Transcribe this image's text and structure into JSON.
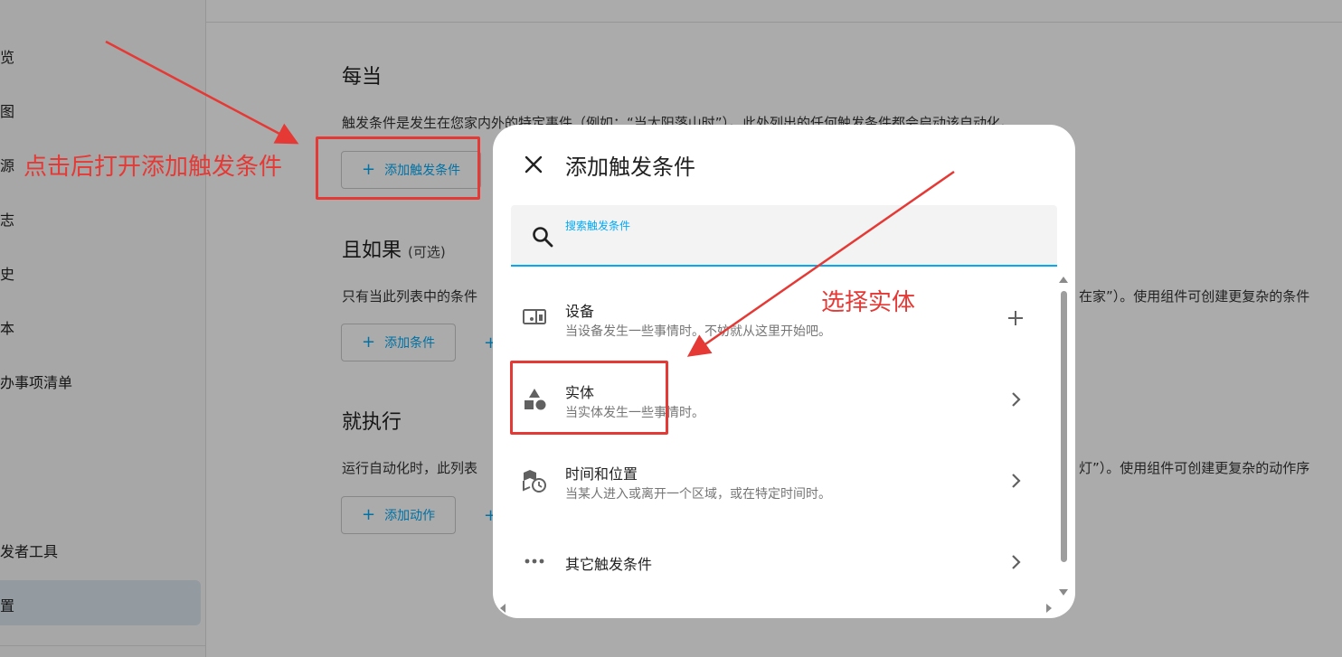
{
  "sidebar": {
    "items": [
      {
        "label": "览"
      },
      {
        "label": "图"
      },
      {
        "label": "源"
      },
      {
        "label": "志"
      },
      {
        "label": "史"
      },
      {
        "label": "本"
      },
      {
        "label": "办事项清单"
      },
      {
        "label": "发者工具"
      },
      {
        "label": "置"
      }
    ]
  },
  "main": {
    "trigger_section": {
      "title": "每当",
      "description": "触发条件是发生在您家内外的特定事件（例如：“当太阳落山时”）。此处列出的任何触发条件都会启动该自动化。",
      "add_button_label": "添加触发条件"
    },
    "condition_section": {
      "title": "且如果",
      "optional": "(可选)",
      "description_left": "只有当此列表中的条件",
      "description_right": "在家”）。使用组件可创建更复杂的条件",
      "add_button_label": "添加条件"
    },
    "action_section": {
      "title": "就执行",
      "description_left": "运行自动化时，此列表",
      "description_right": "灯”）。使用组件可创建更复杂的动作序",
      "add_button_label": "添加动作"
    }
  },
  "dialog": {
    "title": "添加触发条件",
    "search": {
      "label": "搜索触发条件",
      "value": ""
    },
    "items": [
      {
        "title": "设备",
        "subtitle": "当设备发生一些事情时。不妨就从这里开始吧。",
        "icon": "device-icon",
        "action": "plus-icon"
      },
      {
        "title": "实体",
        "subtitle": "当实体发生一些事情时。",
        "icon": "shapes-icon",
        "action": "chevron-right-icon"
      },
      {
        "title": "时间和位置",
        "subtitle": "当某人进入或离开一个区域，或在特定时间时。",
        "icon": "map-clock-icon",
        "action": "chevron-right-icon"
      },
      {
        "title": "其它触发条件",
        "subtitle": "",
        "icon": "more-horiz-icon",
        "action": "chevron-right-icon"
      }
    ]
  },
  "annotations": {
    "click_note": "点击后打开添加触发条件",
    "select_note": "选择实体",
    "color": "#e53935"
  },
  "colors": {
    "accent": "#03a9f4",
    "sidebar_active": "#dbe7f1"
  }
}
